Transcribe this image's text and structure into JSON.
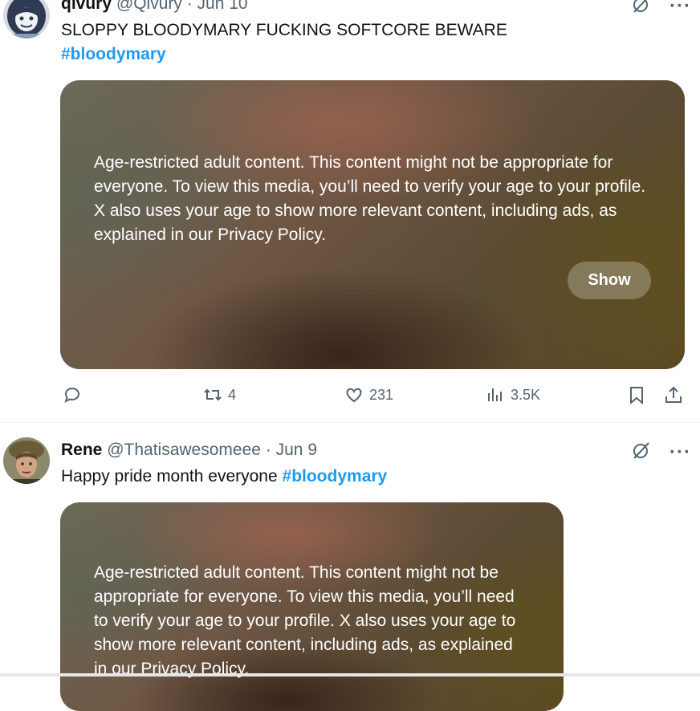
{
  "tweets": [
    {
      "name": "qivury",
      "handle": "@Qivury",
      "date": "Jun 10",
      "text": "SLOPPY BLOODYMARY FUCKING SOFTCORE BEWARE",
      "hashtag": "#bloodymary",
      "media_warning": "Age-restricted adult content. This content might not be appropriate for everyone. To view this media, you’ll need to verify your age to your profile. X also uses your age to show more relevant content, including ads, as explained in our Privacy Policy.",
      "show_label": "Show",
      "reposts": "4",
      "likes": "231",
      "views": "3.5K"
    },
    {
      "name": "Rene",
      "handle": "@Thatisawesomeee",
      "date": "Jun 9",
      "text": "Happy pride month everyone",
      "hashtag": "#bloodymary",
      "media_warning": "Age-restricted adult content. This content might not be appropriate for everyone. To view this media, you’ll need to verify your age to your profile. X also uses your age to show more relevant content, including ads, as explained in our Privacy Policy."
    }
  ],
  "separator": " · ",
  "colors": {
    "hashtag": "#1d9bf0",
    "muted": "#536471",
    "text": "#0f1419"
  },
  "icons": [
    "grok-icon",
    "more-icon",
    "reply-icon",
    "repost-icon",
    "like-icon",
    "views-icon",
    "bookmark-icon",
    "share-icon"
  ]
}
